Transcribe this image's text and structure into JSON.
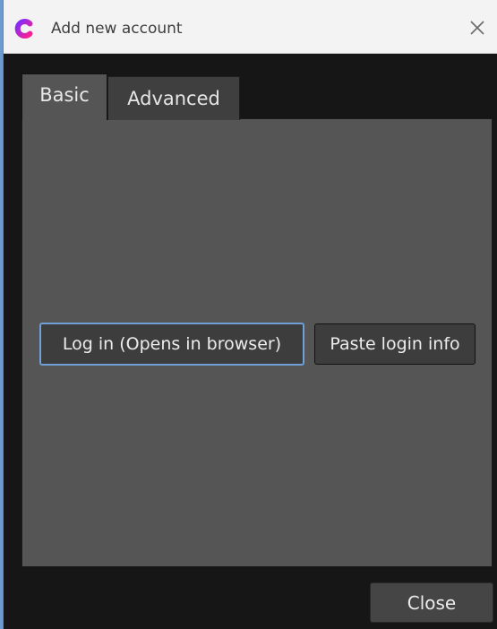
{
  "window": {
    "title": "Add new account",
    "app_icon": "app-logo-icon",
    "close_icon": "close-icon"
  },
  "tabs": [
    {
      "label": "Basic",
      "active": true
    },
    {
      "label": "Advanced",
      "active": false
    }
  ],
  "basic_panel": {
    "login_button": "Log in (Opens in browser)",
    "paste_button": "Paste login info"
  },
  "footer": {
    "close_button": "Close"
  },
  "colors": {
    "accent": "#6e9fd6",
    "logo_magenta": "#e0169b",
    "panel": "#555555",
    "background": "#161616"
  }
}
